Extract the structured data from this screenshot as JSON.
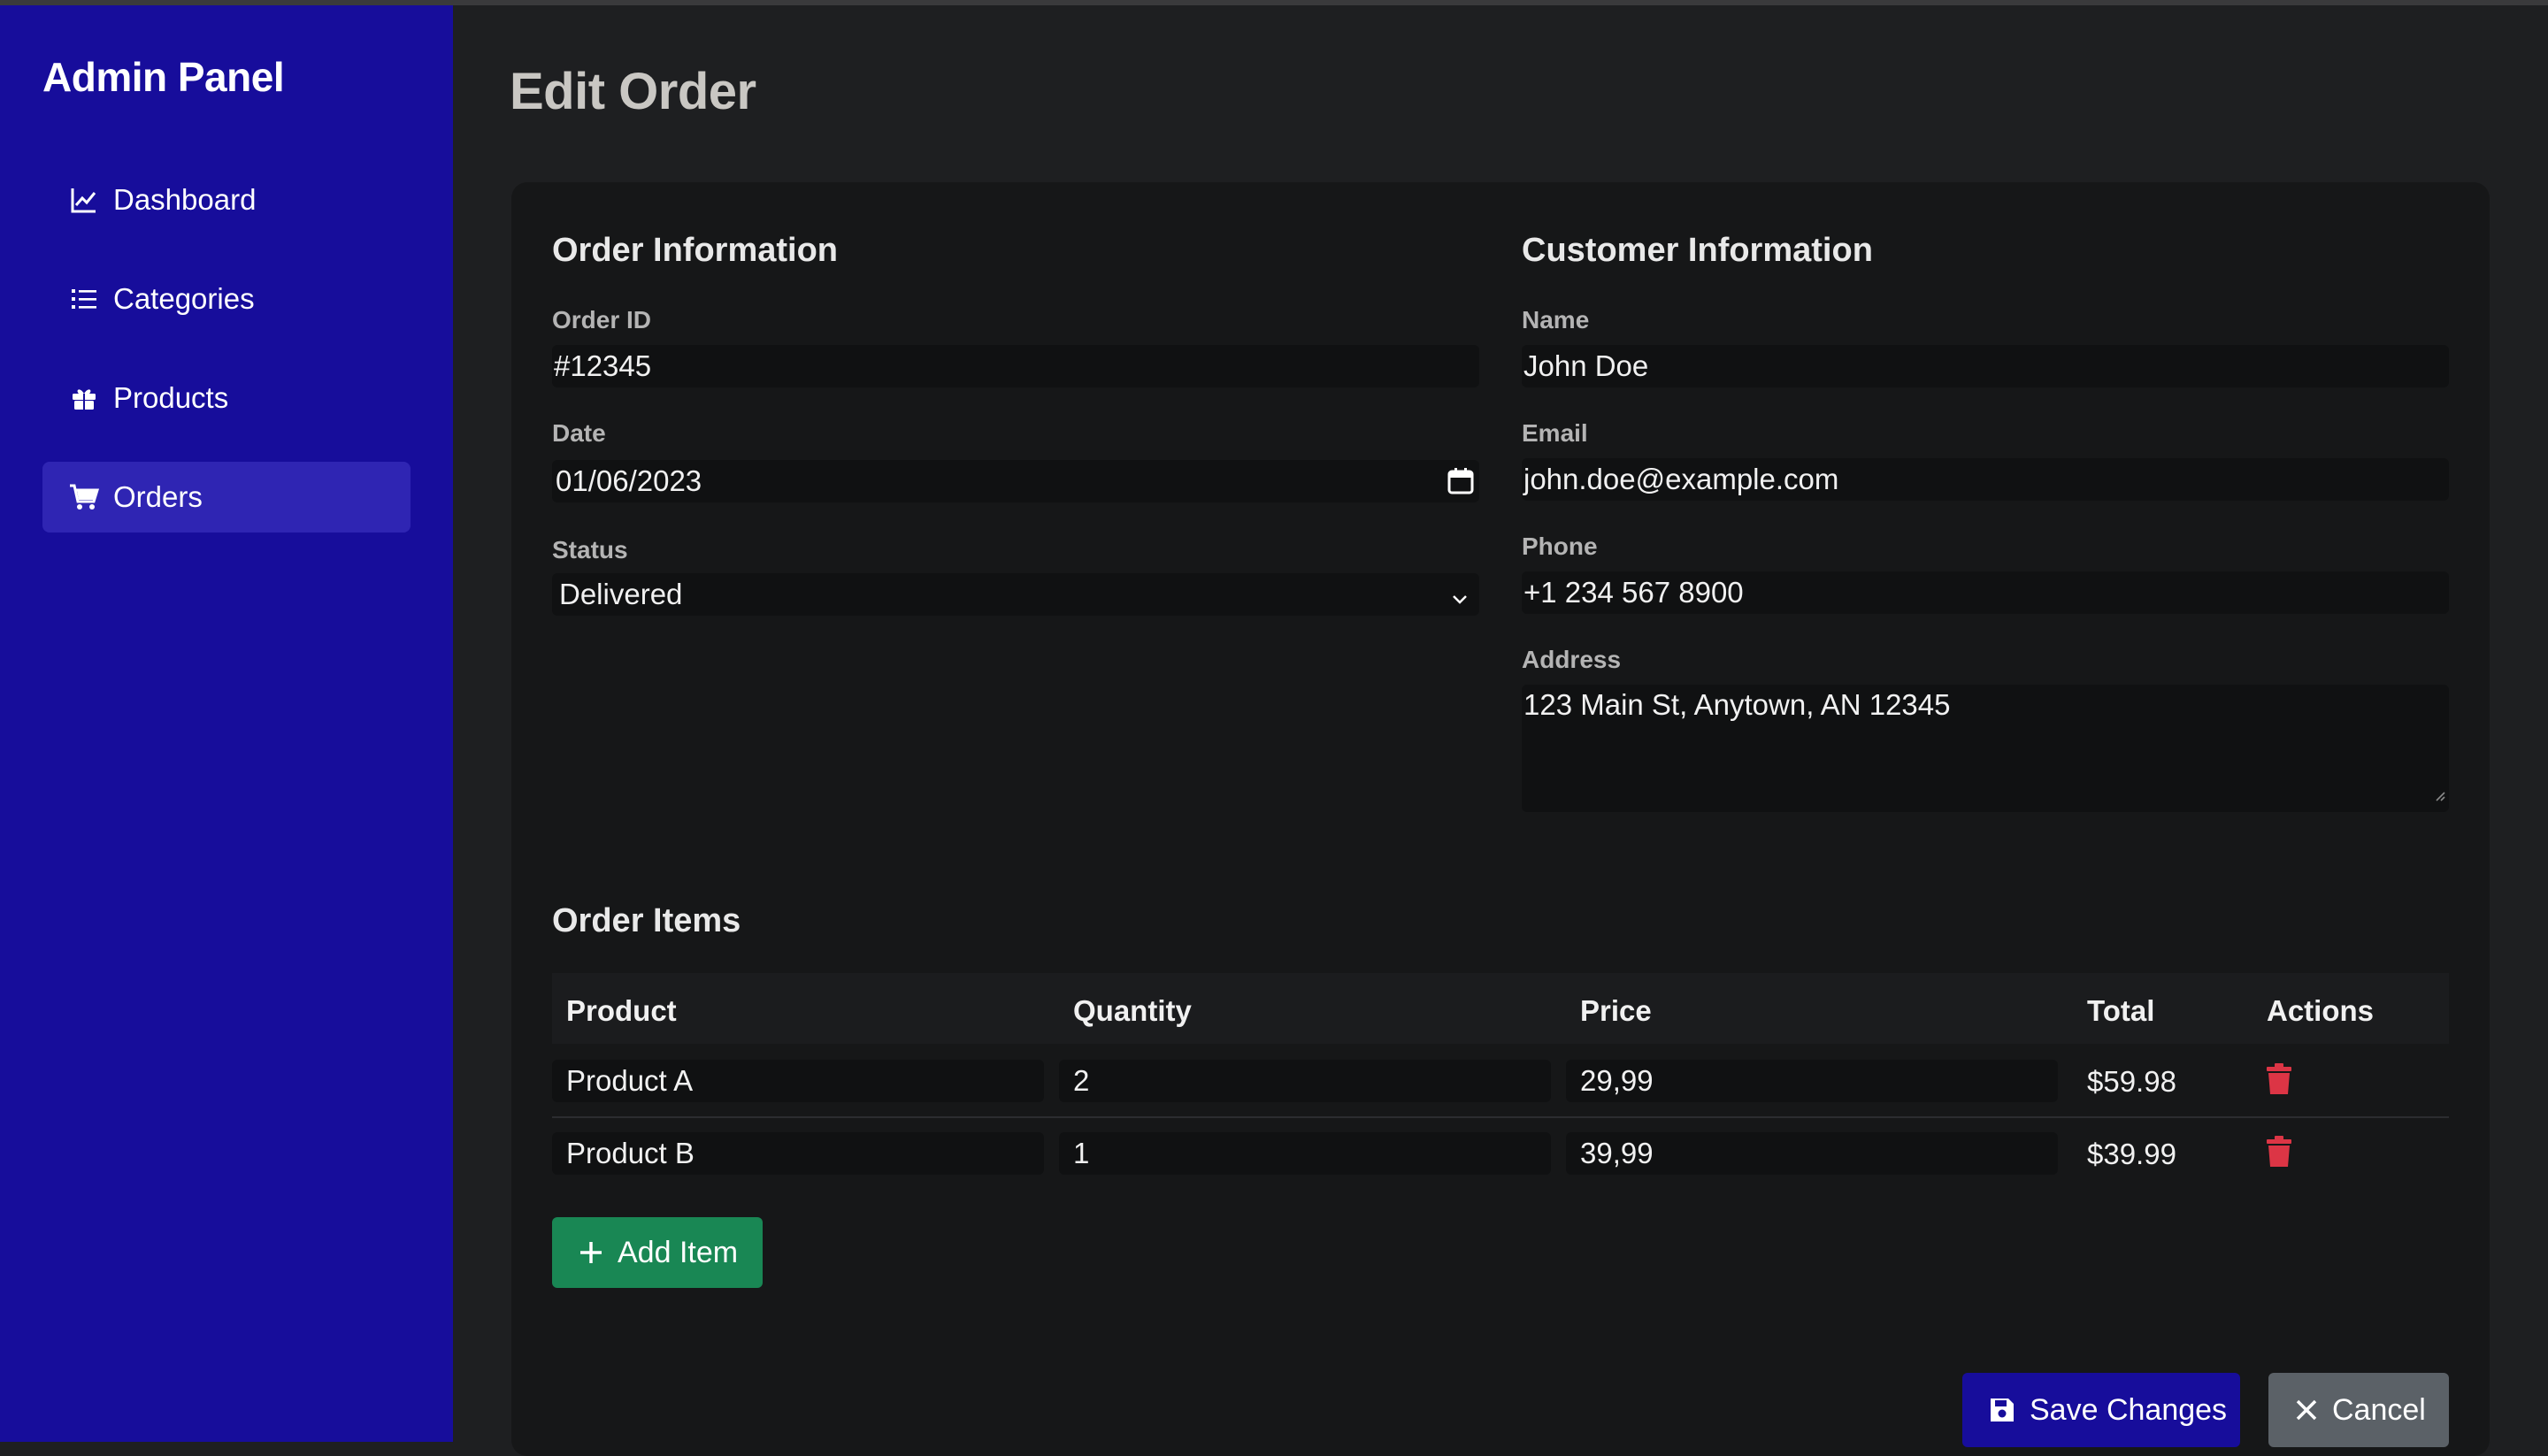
{
  "sidebar": {
    "brand": "Admin Panel",
    "items": [
      {
        "label": "Dashboard",
        "icon": "chart-line-icon"
      },
      {
        "label": "Categories",
        "icon": "list-icon"
      },
      {
        "label": "Products",
        "icon": "gift-box-icon"
      },
      {
        "label": "Orders",
        "icon": "shopping-cart-icon",
        "active": true
      }
    ]
  },
  "page": {
    "title": "Edit Order"
  },
  "order_info": {
    "title": "Order Information",
    "order_id_label": "Order ID",
    "order_id": "#12345",
    "date_label": "Date",
    "date": "01/06/2023",
    "status_label": "Status",
    "status": "Delivered"
  },
  "customer_info": {
    "title": "Customer Information",
    "name_label": "Name",
    "name": "John Doe",
    "email_label": "Email",
    "email": "john.doe@example.com",
    "phone_label": "Phone",
    "phone": "+1 234 567 8900",
    "address_label": "Address",
    "address": "123 Main St, Anytown, AN 12345"
  },
  "items": {
    "title": "Order Items",
    "headers": [
      "Product",
      "Quantity",
      "Price",
      "Total",
      "Actions"
    ],
    "rows": [
      {
        "product": "Product A",
        "quantity": "2",
        "price": "29,99",
        "total": "$59.98"
      },
      {
        "product": "Product B",
        "quantity": "1",
        "price": "39,99",
        "total": "$39.99"
      }
    ],
    "add_label": "Add Item"
  },
  "actions": {
    "save_label": "Save Changes",
    "cancel_label": "Cancel"
  },
  "colors": {
    "sidebar": "#170d9b",
    "active_item": "#2f25b3",
    "add_button": "#198754",
    "delete_icon": "#dc3545",
    "cancel_button": "#5b6167"
  }
}
